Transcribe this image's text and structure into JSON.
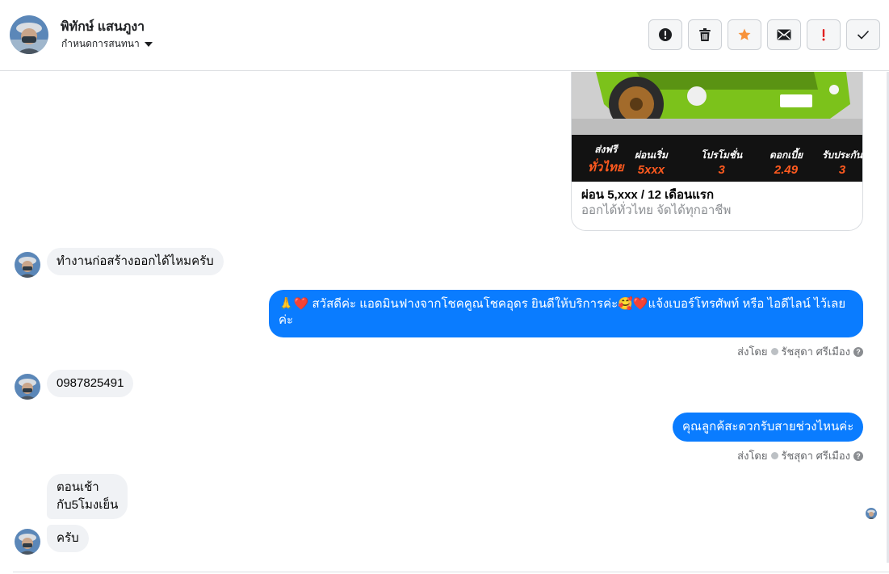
{
  "header": {
    "contact_name": "พิทักษ์ แสนภูงา",
    "assign_label": "กำหนดการสนทนา",
    "toolbar": [
      {
        "name": "spam-button",
        "icon": "alert-circle-icon"
      },
      {
        "name": "delete-button",
        "icon": "trash-icon"
      },
      {
        "name": "star-button",
        "icon": "star-icon"
      },
      {
        "name": "mark-unread-button",
        "icon": "envelope-icon"
      },
      {
        "name": "follow-up-button",
        "icon": "exclamation-icon"
      },
      {
        "name": "done-button",
        "icon": "checkmark-icon"
      }
    ]
  },
  "ad_card": {
    "headline": "ผ่อน 5,xxx / 12 เดือนแรก",
    "description": "ออกได้ทั่วไทย จัดได้ทุกอาชีพ",
    "promos": [
      {
        "title": "ส่งฟรี",
        "value": "ทั่วไทย"
      },
      {
        "title": "ผ่อนเริ่ม",
        "value": "5xxx"
      },
      {
        "title": "โปรโมชั่น",
        "value": "3"
      },
      {
        "title": "ดอกเบี้ย",
        "value": "2.49"
      },
      {
        "title": "รับประกัน",
        "value": "3"
      }
    ]
  },
  "messages": {
    "m1": "ทำงานก่อสร้างออกได้ไหมครับ",
    "m2_line1": "🙏❤️ สวัสดีค่ะ แอดมินฟางจากโชคคูณโชคอุดร ยินดีให้บริการค่ะ🥰❤️แจ้งเบอร์โทรศัพท์ หรือ ไอดีไลน์  ไว้เลย",
    "m2_line2": "ค่ะ",
    "m3": "0987825491",
    "m4": "คุณลูกค้สะดวกรับสายช่วงไหนค่ะ",
    "m5_line1": "ตอนเช้า",
    "m5_line2": "กับ5โมงเย็น",
    "m6": "ครับ"
  },
  "sent_by": {
    "prefix": "ส่งโดย",
    "agent": "รัชสุดา ศรีเมือง",
    "help": "?"
  },
  "colors": {
    "outgoing_bubble": "#0a7cff",
    "incoming_bubble": "#f0f2f5",
    "star": "#f7923a",
    "follow_up": "#e02020"
  }
}
